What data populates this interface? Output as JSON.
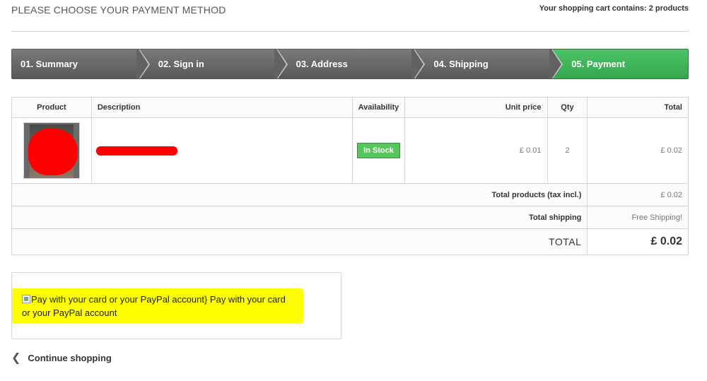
{
  "header": {
    "title": "PLEASE CHOOSE YOUR PAYMENT METHOD",
    "cart_summary": "Your shopping cart contains: 2 products"
  },
  "steps": [
    {
      "label": "01. Summary",
      "active": false
    },
    {
      "label": "02. Sign in",
      "active": false
    },
    {
      "label": "03. Address",
      "active": false
    },
    {
      "label": "04. Shipping",
      "active": false
    },
    {
      "label": "05. Payment",
      "active": true
    }
  ],
  "cart_table": {
    "headers": {
      "product": "Product",
      "description": "Description",
      "availability": "Availability",
      "unit_price": "Unit price",
      "qty": "Qty",
      "total": "Total"
    },
    "items": [
      {
        "availability": "In Stock",
        "unit_price": "£ 0.01",
        "qty": "2",
        "total": "£ 0.02"
      }
    ],
    "totals": {
      "products_label": "Total products (tax incl.)",
      "products_value": "£ 0.02",
      "shipping_label": "Total shipping",
      "shipping_value": "Free Shipping!",
      "grand_label": "TOTAL",
      "grand_value": "£ 0.02"
    }
  },
  "payment": {
    "broken_image_alt": "Pay with your card or your PayPal account}",
    "option_label": "Pay with your card or your PayPal account"
  },
  "footer": {
    "continue_label": "Continue shopping"
  },
  "colors": {
    "active_step": "#3fb357",
    "inactive_step": "#666666",
    "stock_badge": "#55c65e",
    "highlight": "#ffff00",
    "redaction": "#ff0000"
  },
  "icons": {
    "continue": "chevron-left-icon",
    "payment_image": "broken-image-icon"
  }
}
